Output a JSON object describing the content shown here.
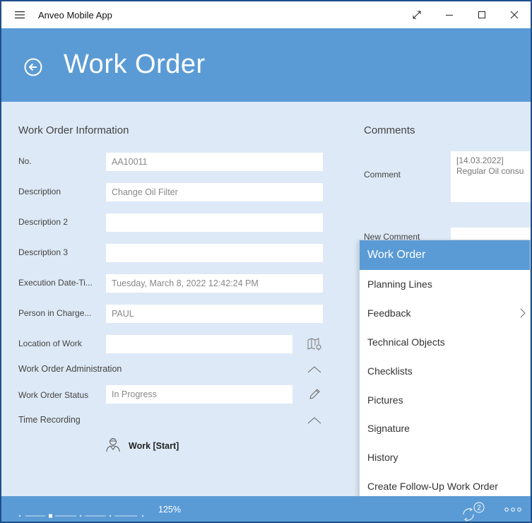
{
  "app": {
    "title": "Anveo Mobile App"
  },
  "header": {
    "title": "Work Order"
  },
  "info_section": {
    "title": "Work Order Information",
    "fields": [
      {
        "label": "No.",
        "value": "AA10011"
      },
      {
        "label": "Description",
        "value": "Change Oil Filter"
      },
      {
        "label": "Description 2",
        "value": ""
      },
      {
        "label": "Description 3",
        "value": ""
      },
      {
        "label": "Execution Date-Ti...",
        "value": "Tuesday, March 8, 2022 12:42:24 PM"
      },
      {
        "label": "Person in Charge...",
        "value": "PAUL"
      },
      {
        "label": "Location of Work",
        "value": ""
      }
    ],
    "admin": {
      "title": "Work Order Administration",
      "status_label": "Work Order Status",
      "status_value": "In Progress"
    },
    "time": {
      "title": "Time Recording",
      "action_label": "Work [Start]"
    }
  },
  "comments_section": {
    "title": "Comments",
    "comment_label": "Comment",
    "comment_line1": "[14.03.2022]",
    "comment_line2": "Regular Oil consu",
    "new_comment_label": "New Comment"
  },
  "popup": {
    "title": "Work Order",
    "items": [
      "Planning Lines",
      "Feedback",
      "Technical Objects",
      "Checklists",
      "Pictures",
      "Signature",
      "History",
      "Create Follow-Up Work Order"
    ]
  },
  "footer": {
    "zoom": "125%",
    "zoom_level": 0.25,
    "sync_count": "2"
  },
  "colors": {
    "accent": "#5b9bd5",
    "background": "#dde9f6",
    "border": "#1f4e8c"
  }
}
